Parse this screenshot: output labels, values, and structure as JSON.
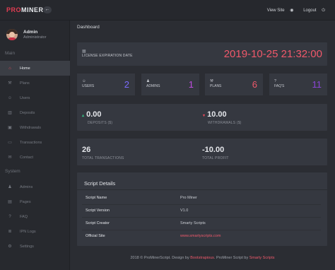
{
  "brand": {
    "part1": "PRO",
    "part2": "MINER",
    "toggle_icon": "arrow-left-icon"
  },
  "top_links": {
    "view_site": "View Site",
    "view_site_icon": "globe-icon",
    "logout": "Logout",
    "logout_icon": "power-icon"
  },
  "user": {
    "name": "Admin",
    "role": "Administrator"
  },
  "sidebar": {
    "main_label": "Main",
    "main_items": [
      {
        "label": "Home",
        "icon": "home-icon",
        "active": true
      },
      {
        "label": "Plans",
        "icon": "plans-icon"
      },
      {
        "label": "Users",
        "icon": "users-icon"
      },
      {
        "label": "Deposits",
        "icon": "bank-icon"
      },
      {
        "label": "Withdrawals",
        "icon": "withdraw-icon"
      },
      {
        "label": "Transactions",
        "icon": "card-icon"
      },
      {
        "label": "Contact",
        "icon": "envelope-icon"
      }
    ],
    "system_label": "System",
    "system_items": [
      {
        "label": "Admins",
        "icon": "user-shield-icon"
      },
      {
        "label": "Pages",
        "icon": "file-icon"
      },
      {
        "label": "FAQ",
        "icon": "question-icon"
      },
      {
        "label": "IPN Logs",
        "icon": "log-icon"
      },
      {
        "label": "Settings",
        "icon": "gear-icon"
      }
    ]
  },
  "breadcrumb": "Dashboard",
  "license": {
    "label": "LICENSE EXPIRATION DATE",
    "date": "2019-10-25 21:32:00",
    "icon": "calendar-icon"
  },
  "stats": [
    {
      "label": "USERS",
      "value": "2",
      "icon": "users-icon",
      "color": "#7b6bff"
    },
    {
      "label": "ADMINS",
      "value": "1",
      "icon": "admin-icon",
      "color": "#c04ce0"
    },
    {
      "label": "PLANS",
      "value": "6",
      "icon": "plans-icon",
      "color": "#f0586a"
    },
    {
      "label": "FAQ'S",
      "value": "11",
      "icon": "question-icon",
      "color": "#8a45d6"
    }
  ],
  "money": {
    "deposits_value": "0.00",
    "deposits_label": "DEPOSITS ($)",
    "withdrawals_value": "10.00",
    "withdrawals_label": "WITHDRAWALS ($)"
  },
  "totals": {
    "transactions_value": "26",
    "transactions_label": "TOTAL TRANSACTIONS",
    "profit_value": "-10.00",
    "profit_label": "TOTAL PROFIT"
  },
  "details": {
    "title": "Script Details",
    "rows": [
      {
        "key": "Script Name",
        "value": "Pro Miner"
      },
      {
        "key": "Script Version",
        "value": "V1.0"
      },
      {
        "key": "Script Creator",
        "value": "Smarty Scripts"
      },
      {
        "key": "Official Site",
        "value": "www.smartyscripts.com"
      }
    ]
  },
  "footer": {
    "prefix": "2018 © ProMinerScript. Design by ",
    "design_link": "Bootstrapious",
    "middle": ". ProMiner Script by ",
    "script_link": "Smarty Scripts"
  }
}
